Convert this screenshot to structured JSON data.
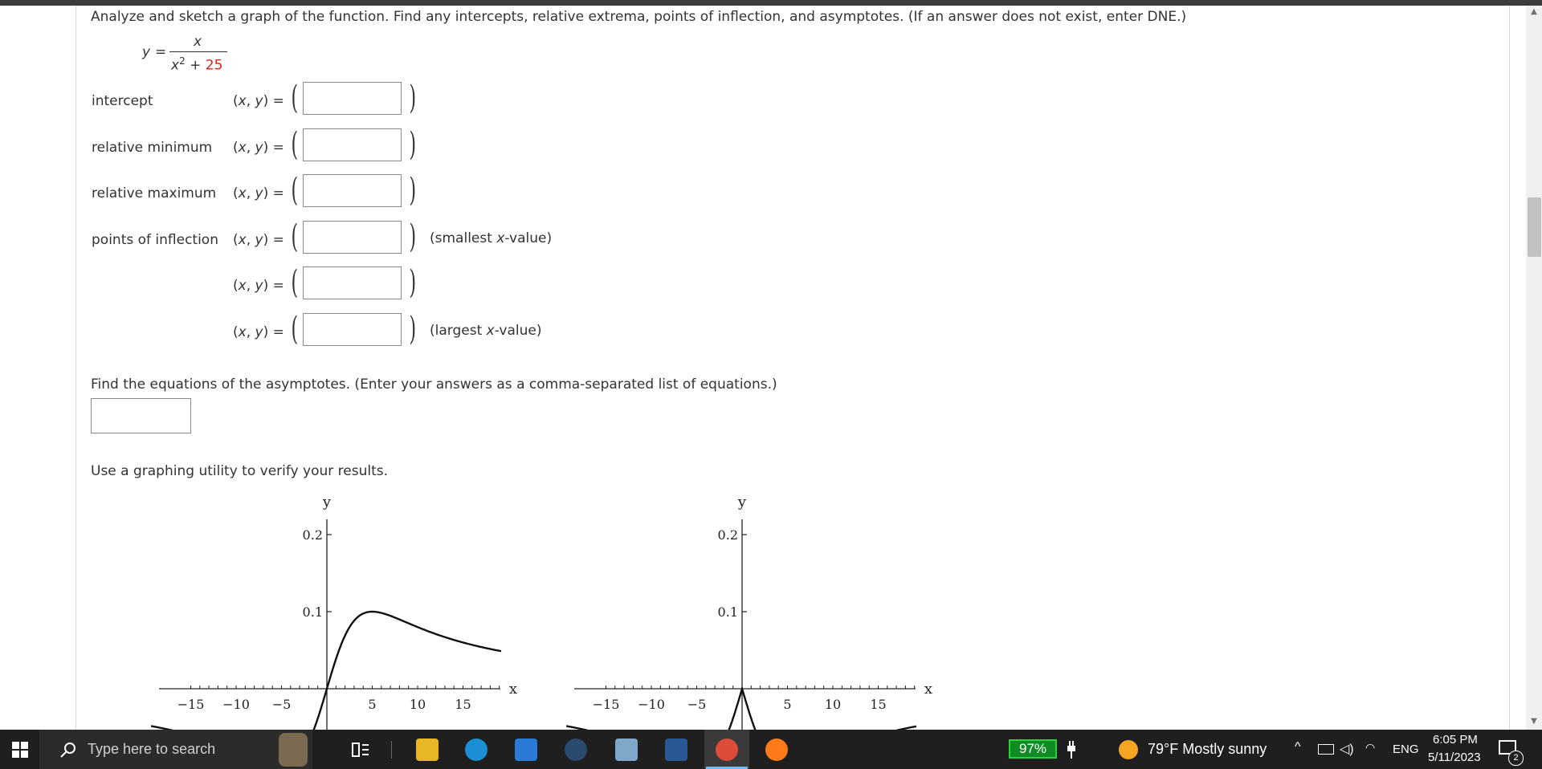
{
  "question": {
    "instruction": "Analyze and sketch a graph of the function. Find any intercepts, relative extrema, points of inflection, and asymptotes. (If an answer does not exist, enter DNE.)",
    "function": {
      "lhs": "y",
      "equals": "=",
      "numerator": "x",
      "denominator_base": "x",
      "denominator_exp": "2",
      "denominator_plus": "+",
      "denominator_const": "25"
    }
  },
  "rows": [
    {
      "label": "intercept",
      "xy": "(x, y) =",
      "value": "",
      "note": ""
    },
    {
      "label": "relative minimum",
      "xy": "(x, y) =",
      "value": "",
      "note": ""
    },
    {
      "label": "relative maximum",
      "xy": "(x, y) =",
      "value": "",
      "note": ""
    },
    {
      "label": "points of inflection",
      "xy": "(x, y) =",
      "value": "",
      "note": "(smallest x-value)"
    },
    {
      "label": "",
      "xy": "(x, y) =",
      "value": "",
      "note": ""
    },
    {
      "label": "",
      "xy": "(x, y) =",
      "value": "",
      "note": "(largest x-value)"
    }
  ],
  "asymptotes": {
    "instruction": "Find the equations of the asymptotes. (Enter your answers as a comma-separated list of equations.)",
    "value": ""
  },
  "verify_text": "Use a graphing utility to verify your results.",
  "graphs": [
    {
      "name": "graph-option-1",
      "xlabel": "x",
      "ylabel": "y",
      "xtick_labels": [
        "−15",
        "−10",
        "−5",
        "5",
        "10",
        "15"
      ],
      "ytick_labels": [
        "0.2",
        "0.1"
      ],
      "xlim": [
        -18,
        19
      ],
      "ylim": [
        -0.06,
        0.22
      ],
      "curve": "x/(x^2+25)"
    },
    {
      "name": "graph-option-2",
      "xlabel": "x",
      "ylabel": "y",
      "xtick_labels": [
        "−15",
        "−10",
        "−5",
        "5",
        "10",
        "15"
      ],
      "ytick_labels": [
        "0.2",
        "0.1"
      ],
      "xlim": [
        -18,
        19
      ],
      "ylim": [
        -0.06,
        0.22
      ],
      "curve": "-|x|/(x^2+25)"
    }
  ],
  "taskbar": {
    "search_placeholder": "Type here to search",
    "battery": "97%",
    "weather": "79°F  Mostly sunny",
    "language": "ENG",
    "time": "6:05 PM",
    "date": "5/11/2023",
    "notification_count": "2",
    "colors": {
      "background": "#1f1f1f",
      "battery": "#0f8b25",
      "chrome_active": "#76b9ed"
    }
  }
}
